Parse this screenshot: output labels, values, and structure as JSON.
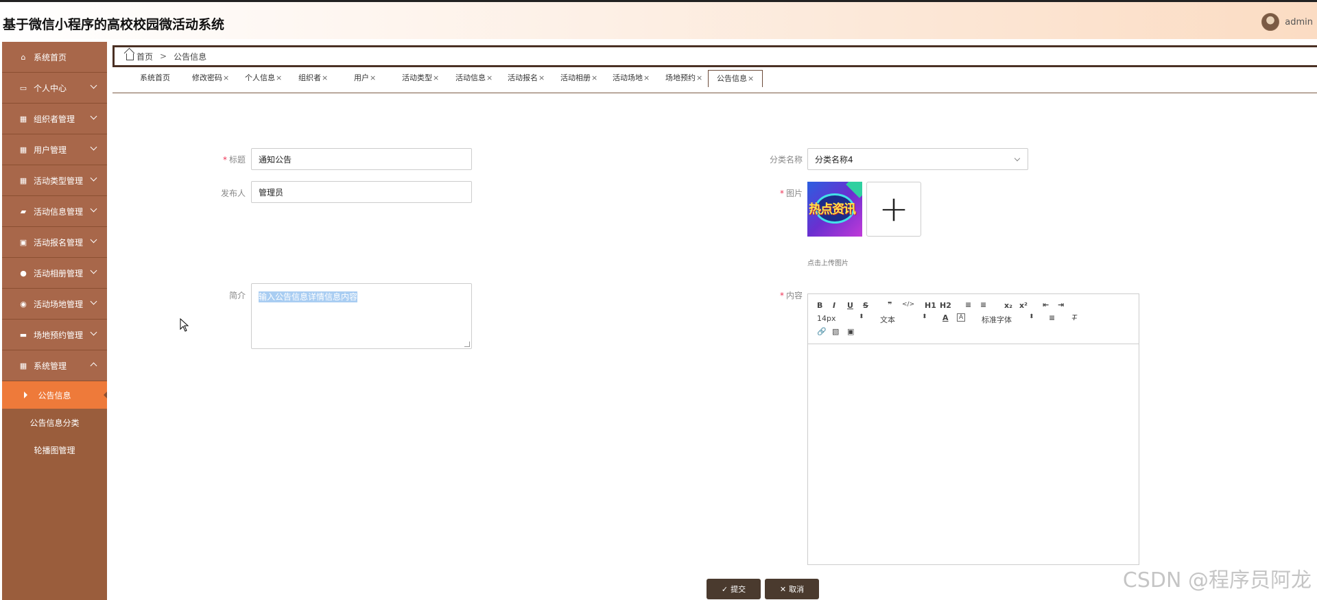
{
  "header": {
    "app_title": "基于微信小程序的高校校园微活动系统",
    "username": "admin"
  },
  "sidebar": {
    "items": [
      {
        "label": "系统首页",
        "icon": "home-icon"
      },
      {
        "label": "个人中心",
        "icon": "profile-card-icon"
      },
      {
        "label": "组织者管理",
        "icon": "grid-icon"
      },
      {
        "label": "用户管理",
        "icon": "grid-icon"
      },
      {
        "label": "活动类型管理",
        "icon": "grid-icon"
      },
      {
        "label": "活动信息管理",
        "icon": "chat-icon"
      },
      {
        "label": "活动报名管理",
        "icon": "briefcase-icon"
      },
      {
        "label": "活动相册管理",
        "icon": "person-icon"
      },
      {
        "label": "活动场地管理",
        "icon": "location-pin-icon"
      },
      {
        "label": "场地预约管理",
        "icon": "bus-icon"
      },
      {
        "label": "系统管理",
        "icon": "grid-icon"
      }
    ],
    "sub_items": [
      "公告信息",
      "公告信息分类",
      "轮播图管理"
    ]
  },
  "breadcrumb": {
    "home": "首页",
    "separator": ">",
    "current": "公告信息"
  },
  "tabs": [
    {
      "label": "系统首页"
    },
    {
      "label": "修改密码"
    },
    {
      "label": "个人信息"
    },
    {
      "label": "组织者"
    },
    {
      "label": "用户"
    },
    {
      "label": "活动类型"
    },
    {
      "label": "活动信息"
    },
    {
      "label": "活动报名"
    },
    {
      "label": "活动相册"
    },
    {
      "label": "活动场地"
    },
    {
      "label": "场地预约"
    },
    {
      "label": "公告信息"
    }
  ],
  "tab_close": "×",
  "form": {
    "title_label": "标题",
    "title_value": "通知公告",
    "publisher_label": "发布人",
    "publisher_value": "管理员",
    "intro_label": "简介",
    "intro_placeholder": "输入公告信息详情信息内容",
    "category_label": "分类名称",
    "category_value": "分类名称4",
    "image_label": "图片",
    "image_text": "热点资讯",
    "upload_plus": "+",
    "upload_hint": "点击上传图片",
    "content_label": "内容",
    "required_mark": "*"
  },
  "editor": {
    "row1": [
      "B",
      "I",
      "U",
      "S",
      "❞",
      "</>",
      "H1",
      "H2",
      "≡",
      "≡",
      "x₂",
      "x²",
      "⇤",
      "⇥"
    ],
    "font_size": "14px",
    "block_type": "文本",
    "font_family": "标准字体"
  },
  "buttons": {
    "submit": "提交",
    "cancel": "取消"
  },
  "watermark": "CSDN @程序员阿龙"
}
